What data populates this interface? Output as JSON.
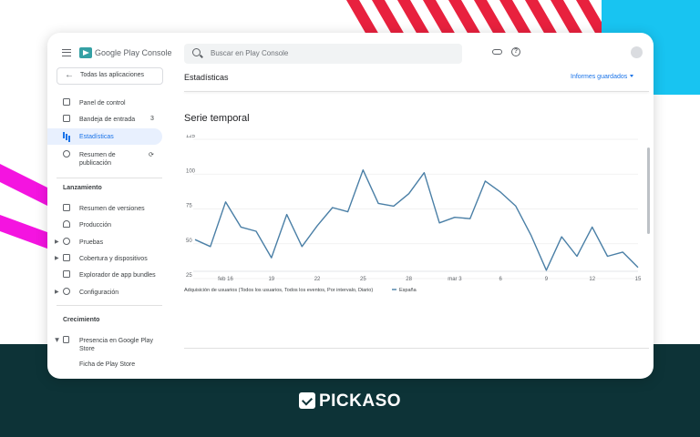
{
  "brand": {
    "name": "PICKASO"
  },
  "app": {
    "title": "Google Play Console"
  },
  "search": {
    "placeholder": "Buscar en Play Console"
  },
  "sidebar": {
    "back_label": "Todas las aplicaciones",
    "items": [
      {
        "label": "Panel de control",
        "icon": "dashboard-icon"
      },
      {
        "label": "Bandeja de entrada",
        "badge": "3",
        "icon": "inbox-icon"
      },
      {
        "label": "Estadísticas",
        "icon": "bar-chart-icon",
        "active": true
      },
      {
        "label": "Resumen de publicación",
        "icon": "publishing-overview-icon"
      }
    ],
    "launch_heading": "Lanzamiento",
    "launch_items": [
      {
        "label": "Resumen de versiones",
        "icon": "releases-icon"
      },
      {
        "label": "Producción",
        "icon": "production-icon"
      },
      {
        "label": "Pruebas",
        "icon": "testing-icon"
      },
      {
        "label": "Cobertura y dispositivos",
        "icon": "devices-icon"
      },
      {
        "label": "Explorador de app bundles",
        "icon": "bundle-icon"
      },
      {
        "label": "Configuración",
        "icon": "gear-icon"
      }
    ],
    "growth_heading": "Crecimiento",
    "growth_items": [
      {
        "label": "Presencia en Google Play Store",
        "icon": "play-icon"
      },
      {
        "label": "Ficha de Play Store"
      }
    ]
  },
  "main": {
    "page_title": "Estadísticas",
    "saved_reports": "Informes guardados",
    "chart_title": "Serie temporal"
  },
  "colors": {
    "accent": "#1a73e8",
    "line": "#4a7fa6",
    "dark_band": "#0d3337",
    "cyan": "#18c4f1",
    "magenta": "#f414e0",
    "stripe_red": "#e8213e"
  },
  "chart_data": {
    "type": "line",
    "title": "Serie temporal",
    "x_ticks": [
      "feb 16",
      "19",
      "22",
      "25",
      "28",
      "mar 3",
      "6",
      "9",
      "12",
      "15"
    ],
    "y_ticks": [
      25,
      50,
      75,
      100,
      125
    ],
    "ylim": [
      25,
      125
    ],
    "series": [
      {
        "name": "España",
        "values": [
          53,
          48,
          80,
          62,
          59,
          40,
          71,
          48,
          63,
          76,
          73,
          103,
          79,
          77,
          86,
          101,
          65,
          69,
          68,
          95,
          87,
          77,
          56,
          31,
          55,
          41,
          62,
          41,
          44,
          33
        ]
      }
    ],
    "legend_caption": "Adquisición de usuarios (Todos los usuarios, Todos los eventos, Por intervalo, Diario)",
    "grid": true
  }
}
